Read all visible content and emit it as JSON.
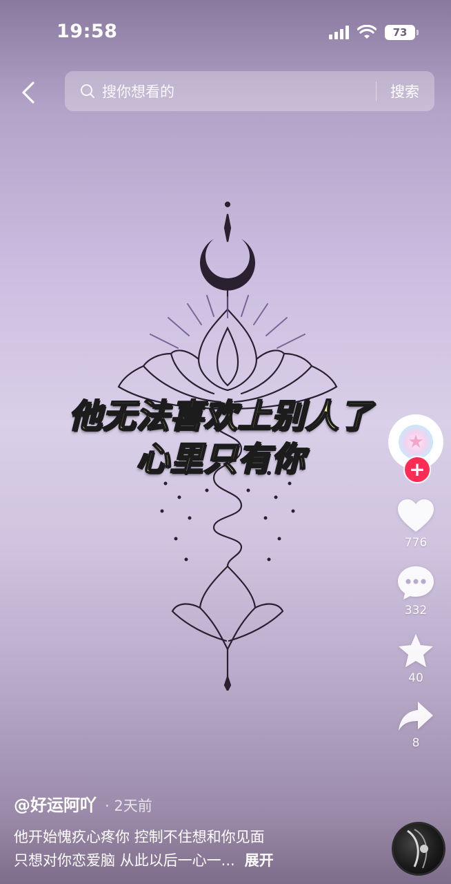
{
  "status_bar": {
    "time": "19:58",
    "battery": "73"
  },
  "search": {
    "placeholder": "搜你想看的",
    "button_label": "搜索"
  },
  "video": {
    "caption_lines": [
      "他无法喜欢上别人了",
      "心里只有你"
    ]
  },
  "actions": {
    "likes": "776",
    "comments": "332",
    "favorites": "40",
    "shares": "8"
  },
  "post": {
    "author": "@好运阿吖",
    "date": "· 2天前",
    "description_line1": "他开始愧疚心疼你 控制不住想和你见面",
    "description_line2": "只想对你恋爱脑 从此以后一心一...",
    "expand_label": "展开"
  },
  "colors": {
    "accent_plus": "#fe2c55",
    "caption_fill": "#f7f29a"
  }
}
